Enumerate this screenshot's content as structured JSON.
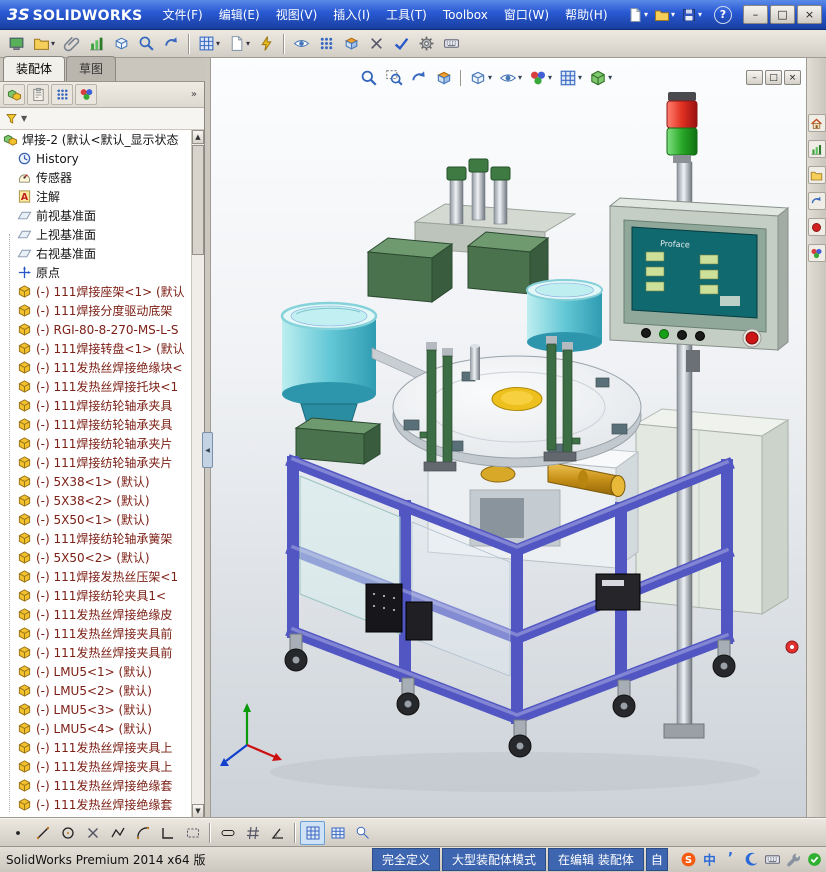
{
  "colors": {
    "titlebar-blue": "#2a5ad4",
    "status-blue": "#3e66b0",
    "frame-blue": "#5156c2",
    "bowl-cyan": "#64c8d6",
    "brass-gold": "#c89018",
    "tower-red": "#e03020",
    "tower-green": "#28a828"
  },
  "titlebar": {
    "logo_mark": "3S",
    "logo_text": "SOLIDWORKS",
    "help_label": "?",
    "menus": [
      {
        "label": "文件(F)",
        "name": "menu-file"
      },
      {
        "label": "编辑(E)",
        "name": "menu-edit"
      },
      {
        "label": "视图(V)",
        "name": "menu-view"
      },
      {
        "label": "插入(I)",
        "name": "menu-insert"
      },
      {
        "label": "工具(T)",
        "name": "menu-tools"
      },
      {
        "label": "Toolbox",
        "name": "menu-toolbox"
      },
      {
        "label": "窗口(W)",
        "name": "menu-window"
      },
      {
        "label": "帮助(H)",
        "name": "menu-help"
      }
    ],
    "quick_icons": [
      {
        "icon": "page",
        "caret": true,
        "name": "new-document-button"
      },
      {
        "icon": "folder",
        "caret": true,
        "name": "open-document-button"
      },
      {
        "icon": "disk",
        "caret": true,
        "name": "save-button"
      }
    ],
    "window_buttons": [
      {
        "glyph": "–",
        "name": "minimize-button"
      },
      {
        "glyph": "□",
        "name": "restore-button"
      },
      {
        "glyph": "×",
        "name": "close-button"
      }
    ]
  },
  "main_toolbar": {
    "items": [
      {
        "icon": "screen-green",
        "name": "view-settings-button"
      },
      {
        "icon": "folder",
        "caret": true,
        "name": "open-recent-button"
      },
      {
        "icon": "clip",
        "name": "attachments-button"
      },
      {
        "icon": "chart-green",
        "name": "evaluate-button"
      },
      {
        "icon": "cube-wire",
        "name": "component-preview-button"
      },
      {
        "icon": "magnifier",
        "name": "find-references-button"
      },
      {
        "icon": "arrow-blue",
        "name": "reload-button"
      },
      {
        "sep": true
      },
      {
        "icon": "grid-blue",
        "caret": true,
        "name": "insert-component-button"
      },
      {
        "icon": "page",
        "caret": true,
        "name": "new-part-button"
      },
      {
        "icon": "flash",
        "name": "quick-snapshot-button"
      },
      {
        "sep": true
      },
      {
        "icon": "eye",
        "name": "hide-show-button"
      },
      {
        "icon": "pattern",
        "name": "pattern-button"
      },
      {
        "icon": "section",
        "name": "section-button"
      },
      {
        "icon": "cross",
        "name": "interference-check-button"
      },
      {
        "icon": "check-blue",
        "name": "verify-button"
      },
      {
        "icon": "gear",
        "name": "options-button"
      },
      {
        "icon": "keyboard",
        "name": "macro-button"
      }
    ]
  },
  "tabs": {
    "items": [
      {
        "label": "装配体",
        "cls": "active",
        "name": "tab-assembly"
      },
      {
        "label": "草图",
        "name": "tab-sketch"
      }
    ]
  },
  "panel": {
    "chevron": "»",
    "toolbar_icons": [
      {
        "icon": "assembly",
        "name": "featuremanager-tab"
      },
      {
        "icon": "clipboard",
        "name": "propertymanager-tab"
      },
      {
        "icon": "pattern",
        "name": "configurationmanager-tab"
      },
      {
        "icon": "sphere-rgb",
        "name": "displaymanager-tab"
      }
    ],
    "filter_caret": "▼",
    "scroll_up": "▲",
    "scroll_down": "▼",
    "splitter_glyph": "◀"
  },
  "tree": {
    "items": [
      {
        "icon": "assembly",
        "label": "焊接-2 (默认<默认_显示状态",
        "cls": "root",
        "name": "tree-root-assembly"
      },
      {
        "icon": "history",
        "label": "History"
      },
      {
        "icon": "sensor",
        "label": "传感器"
      },
      {
        "icon": "annotation",
        "label": "注解"
      },
      {
        "icon": "plane",
        "label": "前视基准面"
      },
      {
        "icon": "plane",
        "label": "上视基准面"
      },
      {
        "icon": "plane",
        "label": "右视基准面"
      },
      {
        "icon": "origin",
        "label": "原点"
      },
      {
        "icon": "part",
        "label": "(-) 111焊接座架<1> (默认",
        "cls": "comp"
      },
      {
        "icon": "part",
        "label": "(-) 111焊接分度驱动底架",
        "cls": "comp"
      },
      {
        "icon": "part",
        "label": "(-) RGI-80-8-270-MS-L-S",
        "cls": "comp"
      },
      {
        "icon": "part",
        "label": "(-) 111焊接转盘<1> (默认",
        "cls": "comp"
      },
      {
        "icon": "part",
        "label": "(-) 111发热丝焊接绝缘块<",
        "cls": "comp"
      },
      {
        "icon": "part",
        "label": "(-) 111发热丝焊接托块<1",
        "cls": "comp"
      },
      {
        "icon": "part",
        "label": "(-) 111焊接纺轮轴承夹具",
        "cls": "comp"
      },
      {
        "icon": "part",
        "label": "(-) 111焊接纺轮轴承夹具",
        "cls": "comp"
      },
      {
        "icon": "part",
        "label": "(-) 111焊接纺轮轴承夹片",
        "cls": "comp"
      },
      {
        "icon": "part",
        "label": "(-) 111焊接纺轮轴承夹片",
        "cls": "comp"
      },
      {
        "icon": "part",
        "label": "(-) 5X38<1> (默认)",
        "cls": "comp"
      },
      {
        "icon": "part",
        "label": "(-) 5X38<2> (默认)",
        "cls": "comp"
      },
      {
        "icon": "part",
        "label": "(-) 5X50<1> (默认)",
        "cls": "comp"
      },
      {
        "icon": "part",
        "label": "(-) 111焊接纺轮轴承簧架",
        "cls": "comp"
      },
      {
        "icon": "part",
        "label": "(-) 5X50<2> (默认)",
        "cls": "comp"
      },
      {
        "icon": "part",
        "label": "(-) 111焊接发热丝压架<1",
        "cls": "comp"
      },
      {
        "icon": "part",
        "label": "(-) 111焊接纺轮夹具1<",
        "cls": "comp"
      },
      {
        "icon": "part",
        "label": "(-) 111发热丝焊接绝缘皮",
        "cls": "comp"
      },
      {
        "icon": "part",
        "label": "(-) 111发热丝焊接夹具前",
        "cls": "comp"
      },
      {
        "icon": "part",
        "label": "(-) 111发热丝焊接夹具前",
        "cls": "comp"
      },
      {
        "icon": "part",
        "label": "(-) LMU5<1> (默认)",
        "cls": "comp"
      },
      {
        "icon": "part",
        "label": "(-) LMU5<2> (默认)",
        "cls": "comp"
      },
      {
        "icon": "part",
        "label": "(-) LMU5<3> (默认)",
        "cls": "comp"
      },
      {
        "icon": "part",
        "label": "(-) LMU5<4> (默认)",
        "cls": "comp"
      },
      {
        "icon": "part",
        "label": "(-) 111发热丝焊接夹具上",
        "cls": "comp"
      },
      {
        "icon": "part",
        "label": "(-) 111发热丝焊接夹具上",
        "cls": "comp"
      },
      {
        "icon": "part",
        "label": "(-) 111发热丝焊接绝缘套",
        "cls": "comp"
      },
      {
        "icon": "part",
        "label": "(-) 111发热丝焊接绝缘套",
        "cls": "comp"
      }
    ]
  },
  "viewport": {
    "hmi_brand": "Proface",
    "headsup_icons": [
      {
        "icon": "magnifier",
        "name": "zoom-fit-button"
      },
      {
        "icon": "magnifier-area",
        "name": "zoom-area-button"
      },
      {
        "icon": "arrow-blue",
        "name": "previous-view-button"
      },
      {
        "icon": "section",
        "name": "section-view-button"
      },
      {
        "sep": true
      },
      {
        "icon": "cube-wire",
        "caret": true,
        "name": "display-style-button"
      },
      {
        "icon": "eye",
        "caret": true,
        "name": "hide-show-items-button"
      },
      {
        "icon": "sphere-rgb",
        "caret": true,
        "name": "edit-appearance-button"
      },
      {
        "icon": "grid-blue",
        "caret": true,
        "name": "apply-scene-button"
      },
      {
        "icon": "cube-green",
        "caret": true,
        "name": "view-orientation-button"
      }
    ],
    "doc_buttons": [
      {
        "glyph": "–",
        "name": "doc-minimize-button"
      },
      {
        "glyph": "□",
        "name": "doc-restore-button"
      },
      {
        "glyph": "×",
        "name": "doc-close-button"
      }
    ]
  },
  "taskpane": {
    "icons": [
      {
        "icon": "home",
        "name": "resources-tab"
      },
      {
        "icon": "chart-green",
        "name": "design-library-tab"
      },
      {
        "icon": "folder",
        "name": "file-explorer-tab"
      },
      {
        "icon": "arrow-blue",
        "name": "view-palette-tab"
      },
      {
        "icon": "record",
        "name": "appearances-tab"
      },
      {
        "icon": "sphere-rgb",
        "name": "custom-properties-tab"
      }
    ]
  },
  "sketch_toolbar": {
    "items": [
      {
        "icon": "point",
        "name": "sketch-point-tool"
      },
      {
        "icon": "line",
        "name": "sketch-line-tool"
      },
      {
        "icon": "circle-sk",
        "name": "sketch-circle-tool"
      },
      {
        "icon": "cross",
        "name": "sketch-trim-tool"
      },
      {
        "icon": "polyline",
        "name": "sketch-polyline-tool"
      },
      {
        "icon": "arc",
        "name": "sketch-arc-tool"
      },
      {
        "icon": "corner",
        "name": "sketch-corner-rectangle-tool"
      },
      {
        "icon": "rect-dashed",
        "name": "sketch-rectangle-tool"
      },
      {
        "sep": true
      },
      {
        "icon": "slot",
        "name": "sketch-slot-tool"
      },
      {
        "icon": "hash",
        "name": "sketch-hatch-tool"
      },
      {
        "icon": "angle",
        "name": "smart-dimension-tool"
      },
      {
        "sep": true
      },
      {
        "icon": "grid-blue",
        "cls": "pressed",
        "name": "grid-snap-toggle"
      },
      {
        "icon": "table-sk",
        "name": "table-tool"
      },
      {
        "icon": "balloon",
        "name": "balloon-tool"
      }
    ]
  },
  "statusbar": {
    "left_text": "SolidWorks Premium 2014 x64 版",
    "segments": [
      {
        "label": "完全定义",
        "name": "definition-status"
      },
      {
        "label": "大型装配体模式",
        "name": "large-assembly-mode-status"
      },
      {
        "label": "在编辑 装配体",
        "name": "editing-status"
      },
      {
        "label": "自",
        "cls": "clip",
        "name": "clipped-status"
      }
    ],
    "tray": [
      {
        "icon": "sogou",
        "name": "sogou-input-icon"
      },
      {
        "icon": "zh",
        "name": "chinese-mode-icon"
      },
      {
        "icon": "comma",
        "name": "punctuation-icon"
      },
      {
        "icon": "moon",
        "name": "fullwidth-mode-icon"
      },
      {
        "icon": "keyboard",
        "name": "soft-keyboard-icon"
      },
      {
        "icon": "wrench",
        "name": "input-settings-icon"
      },
      {
        "icon": "shield-green",
        "name": "antivirus-tray-icon"
      }
    ]
  }
}
